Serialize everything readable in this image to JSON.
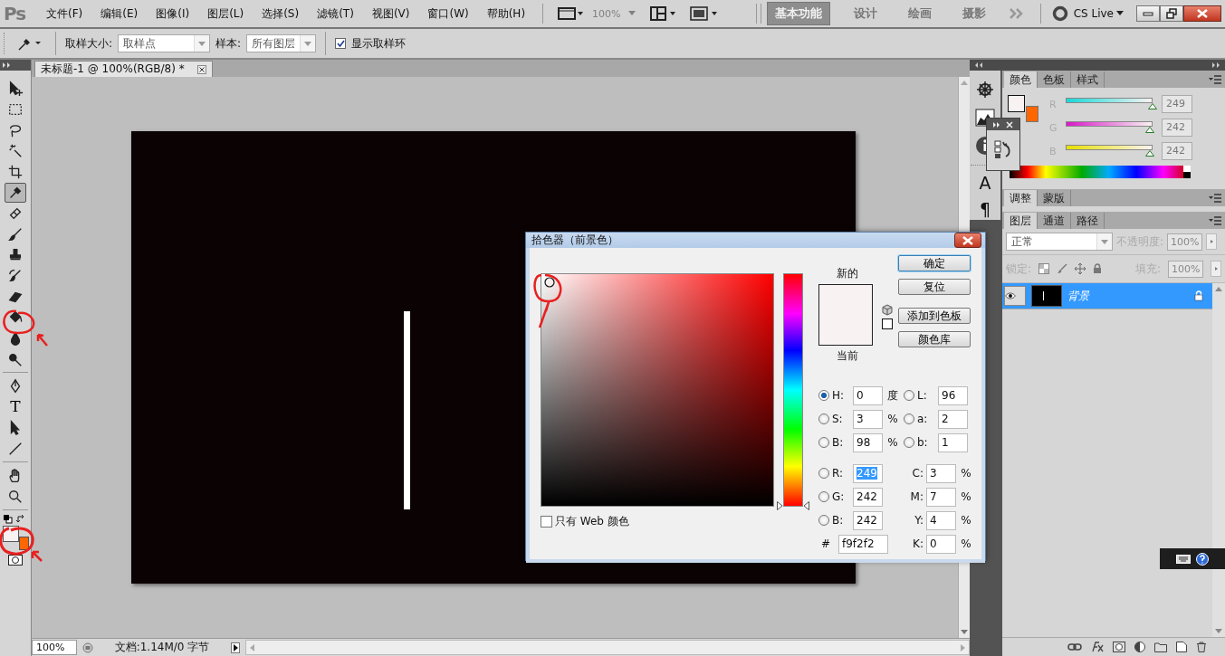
{
  "menu_bar": {
    "logo": "Ps",
    "menus": [
      "文件(F)",
      "编辑(E)",
      "图像(I)",
      "图层(L)",
      "选择(S)",
      "滤镜(T)",
      "视图(V)",
      "窗口(W)",
      "帮助(H)"
    ],
    "zoom": {
      "value": "100%",
      "disabled": true
    },
    "workspaces": [
      {
        "label": "基本功能",
        "selected": true
      },
      {
        "label": "设计",
        "selected": false
      },
      {
        "label": "绘画",
        "selected": false
      },
      {
        "label": "摄影",
        "selected": false
      }
    ],
    "cs_live": "CS Live"
  },
  "options_bar": {
    "sample_size_label": "取样大小:",
    "sample_size": "取样点",
    "sample_label": "样本:",
    "sample": "所有图层",
    "show_ring": {
      "label": "显示取样环",
      "checked": true
    }
  },
  "tool_groups": [
    [
      {
        "kind": "move",
        "selected": false
      },
      {
        "kind": "marquee",
        "selected": false
      },
      {
        "kind": "lasso",
        "selected": false
      },
      {
        "kind": "magic-wand",
        "selected": false
      },
      {
        "kind": "crop",
        "selected": false
      },
      {
        "kind": "eyedropper",
        "selected": true
      },
      {
        "kind": "healing",
        "selected": false
      },
      {
        "kind": "brush",
        "selected": false
      },
      {
        "kind": "stamp",
        "selected": false
      },
      {
        "kind": "history-brush",
        "selected": false
      },
      {
        "kind": "eraser",
        "selected": false
      },
      {
        "kind": "bucket",
        "selected": false
      },
      {
        "kind": "blur",
        "selected": false
      },
      {
        "kind": "dodge",
        "selected": false
      }
    ],
    [
      {
        "kind": "pen",
        "selected": false
      },
      {
        "kind": "type",
        "glyph": "T",
        "selected": false
      },
      {
        "kind": "path-select",
        "selected": false
      },
      {
        "kind": "line",
        "selected": false
      }
    ],
    [
      {
        "kind": "hand",
        "selected": false
      },
      {
        "kind": "zoom",
        "selected": false
      }
    ]
  ],
  "foreground": {
    "color": "#f9f2f2"
  },
  "background": {
    "color": "#ff6600"
  },
  "document": {
    "tab": "未标题-1 @ 100%(RGB/8) *",
    "zoom": "100%",
    "info": "文档:1.14M/0 字节"
  },
  "dock": {
    "character_glyph": "A",
    "paragraph_glyph": "¶"
  },
  "color_panel": {
    "tabs": [
      {
        "label": "颜色",
        "selected": true
      },
      {
        "label": "色板",
        "selected": false
      },
      {
        "label": "样式",
        "selected": false
      }
    ],
    "channels": [
      {
        "kind": "red",
        "name": "R",
        "level": 0.976,
        "value": "249"
      },
      {
        "kind": "green",
        "name": "G",
        "level": 0.949,
        "value": "242"
      },
      {
        "kind": "blue",
        "name": "B",
        "level": 0.949,
        "value": "242"
      }
    ]
  },
  "adjust_panel": {
    "tabs": [
      {
        "label": "调整",
        "selected": true
      },
      {
        "label": "蒙版",
        "selected": false
      }
    ]
  },
  "layers_panel": {
    "tabs": [
      {
        "label": "图层",
        "selected": true
      },
      {
        "label": "通道",
        "selected": false
      },
      {
        "label": "路径",
        "selected": false
      }
    ],
    "blend_mode": "正常",
    "opacity_label": "不透明度:",
    "opacity": "100%",
    "lock_label": "锁定:",
    "fill_label": "填充:",
    "fill": "100%",
    "layers": [
      {
        "name": "背景",
        "selected": true,
        "visible": true,
        "locked": true
      }
    ]
  },
  "color_picker": {
    "title": "拾色器（前景色）",
    "new_label": "新的",
    "current_label": "当前",
    "hue_slider": {
      "level": 0
    },
    "buttons": [
      {
        "label": "确定",
        "default": true
      },
      {
        "label": "复位",
        "default": false
      },
      {
        "label": "添加到色板",
        "default": false
      },
      {
        "label": "颜色库",
        "default": false
      }
    ],
    "hsb_fields": [
      {
        "label": "H:",
        "value": "0",
        "unit": "度",
        "selected": true
      },
      {
        "label": "S:",
        "value": "3",
        "unit": "%",
        "selected": false
      },
      {
        "label": "B:",
        "value": "98",
        "unit": "%",
        "selected": false
      }
    ],
    "rgb_fields": [
      {
        "label": "R:",
        "value": "249",
        "selected": false,
        "highlighted": true
      },
      {
        "label": "G:",
        "value": "242",
        "selected": false,
        "highlighted": false
      },
      {
        "label": "B:",
        "value": "242",
        "selected": false,
        "highlighted": false
      }
    ],
    "hex_label": "#",
    "hex": "f9f2f2",
    "lab_fields": [
      {
        "label": "L:",
        "value": "96",
        "selected": false
      },
      {
        "label": "a:",
        "value": "2",
        "selected": false
      },
      {
        "label": "b:",
        "value": "1",
        "selected": false
      }
    ],
    "cmyk_fields": [
      {
        "label": "C:",
        "value": "3",
        "unit": "%"
      },
      {
        "label": "M:",
        "value": "7",
        "unit": "%"
      },
      {
        "label": "Y:",
        "value": "4",
        "unit": "%"
      },
      {
        "label": "K:",
        "value": "0",
        "unit": "%"
      }
    ],
    "web_only": {
      "label": "只有 Web 颜色",
      "checked": false
    }
  }
}
